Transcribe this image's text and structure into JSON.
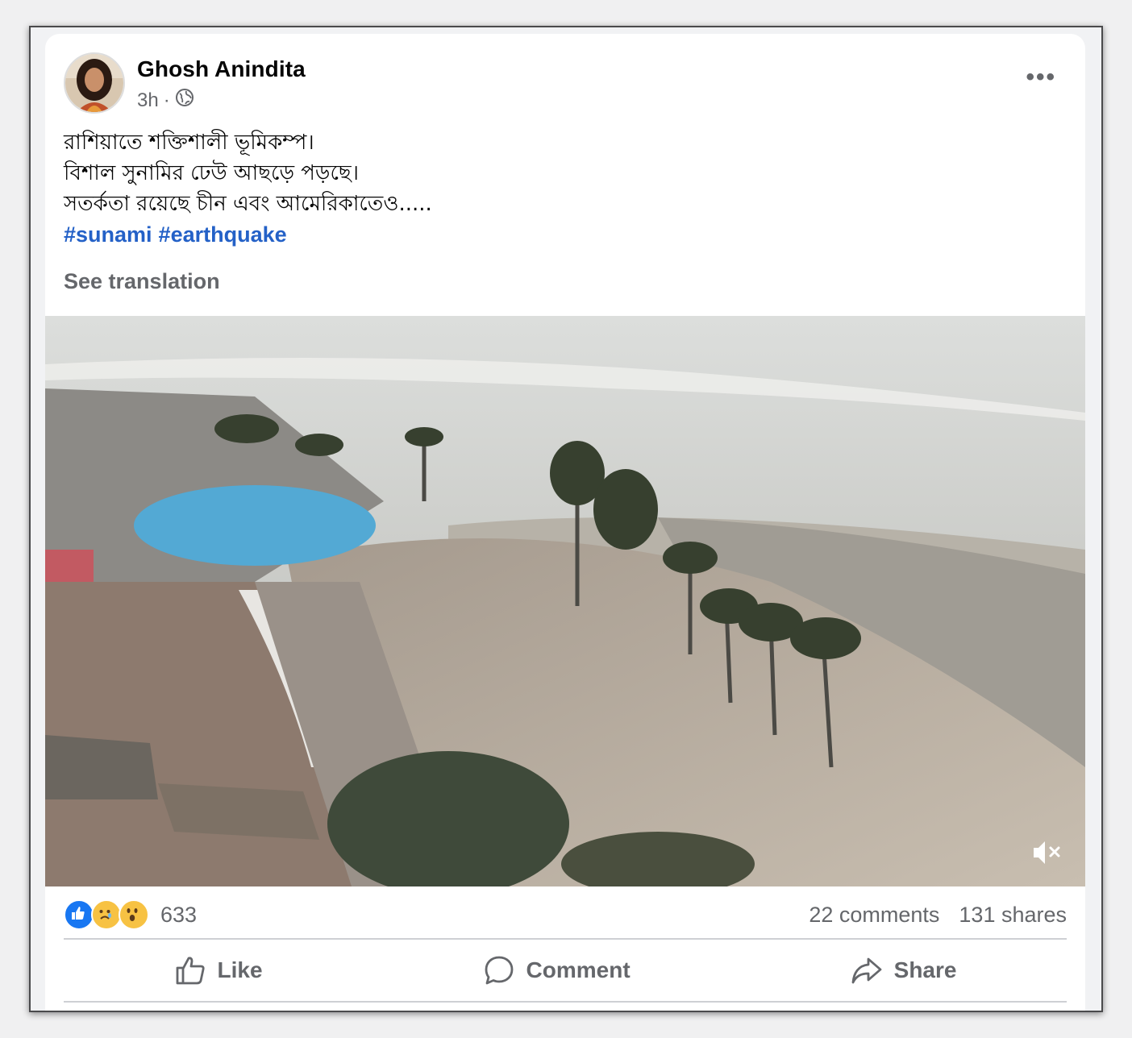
{
  "post": {
    "author": "Ghosh Anindita",
    "time": "3h",
    "separator": "·",
    "privacy_icon": "globe-icon",
    "more_label": "•••",
    "text_lines": [
      "রাশিয়াতে শক্তিশালী ভূমিকম্প।",
      "বিশাল সুনামির ঢেউ আছড়ে পড়ছে।",
      "সতর্কতা রয়েছে চীন এবং আমেরিকাতেও....."
    ],
    "hashtags": [
      "#sunami",
      "#earthquake"
    ],
    "see_translation": "See translation",
    "media": {
      "type": "video",
      "muted": true,
      "mute_icon": "speaker-muted-icon"
    }
  },
  "engagement": {
    "reaction_icons": [
      "like-reaction-icon",
      "sad-reaction-icon",
      "wow-reaction-icon"
    ],
    "reaction_count": "633",
    "comments": "22 comments",
    "shares": "131 shares"
  },
  "actions": {
    "like": "Like",
    "comment": "Comment",
    "share": "Share"
  },
  "colors": {
    "link": "#2461c7",
    "secondary_text": "#65676b",
    "like_blue": "#1877f2"
  }
}
